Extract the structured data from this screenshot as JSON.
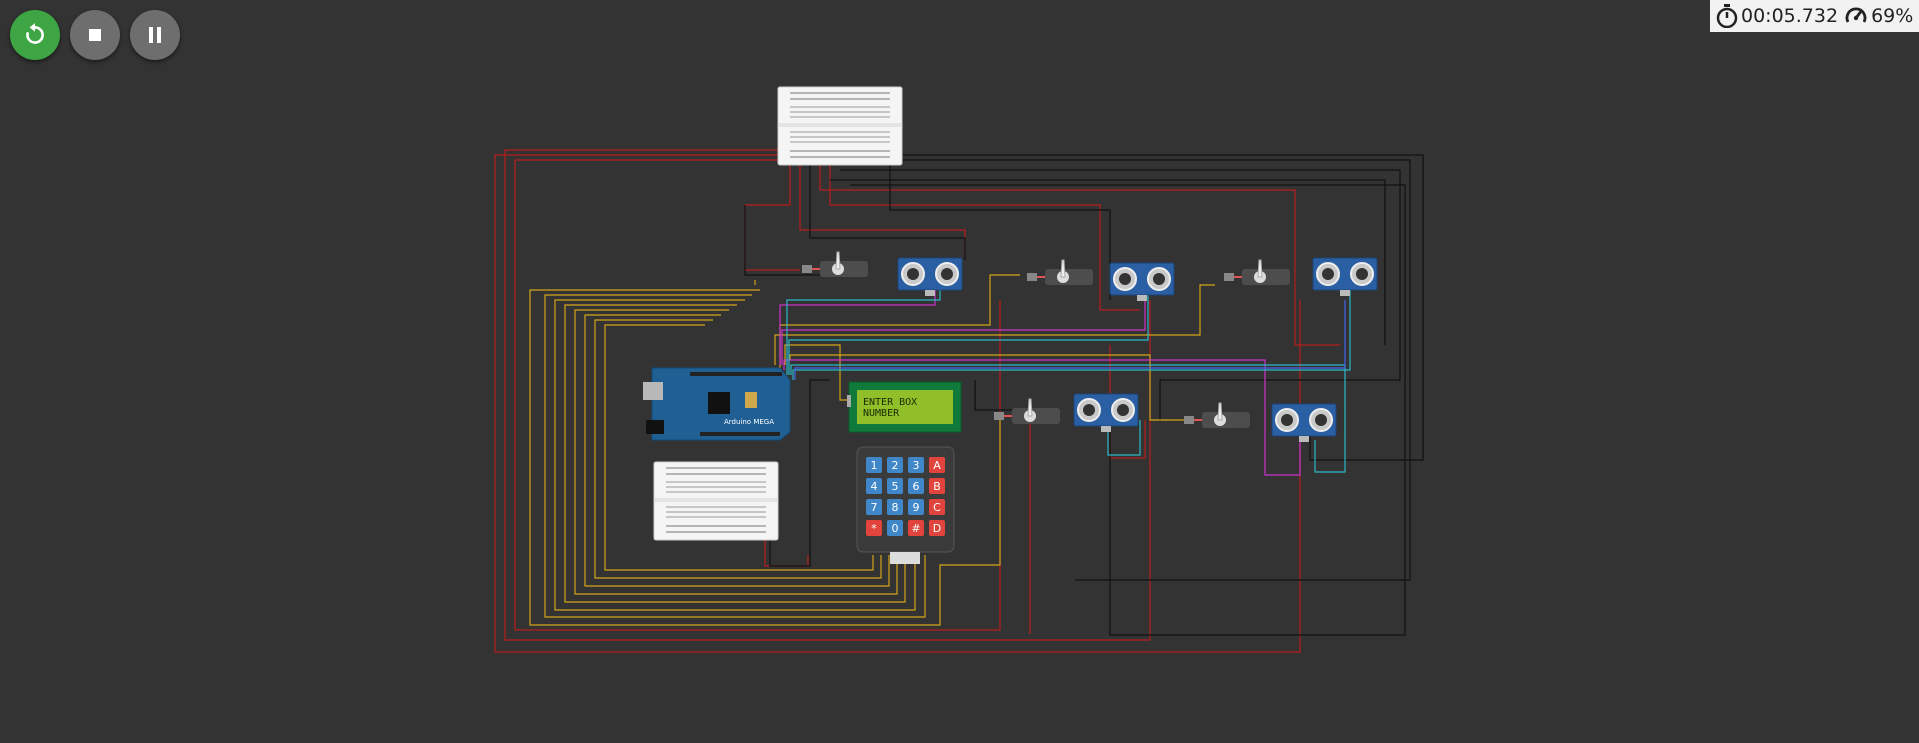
{
  "toolbar": {
    "restart": {
      "icon": "restart-icon",
      "color": "#3da544"
    },
    "stop": {
      "icon": "stop-icon",
      "color": "#6e6e6e"
    },
    "pause": {
      "icon": "pause-icon",
      "color": "#6e6e6e"
    }
  },
  "status": {
    "timer_icon": "stopwatch-icon",
    "elapsed": "00:05.732",
    "speed_icon": "speedometer-icon",
    "speed": "69%"
  },
  "circuit": {
    "board_label": "Arduino MEGA",
    "lcd": {
      "line1": "ENTER BOX",
      "line2": "NUMBER",
      "backlight": "#8fbf2a"
    },
    "keypad": {
      "keys": [
        [
          "1",
          "2",
          "3",
          "A"
        ],
        [
          "4",
          "5",
          "6",
          "B"
        ],
        [
          "7",
          "8",
          "9",
          "C"
        ],
        [
          "*",
          "0",
          "#",
          "D"
        ]
      ],
      "digit_color": "#3f87c8",
      "letter_color": "#e0443c"
    },
    "components": [
      "breadboard-top",
      "breadboard-bottom",
      "arduino-mega",
      "lcd-display",
      "keypad",
      "servo-1",
      "servo-2",
      "servo-3",
      "servo-4",
      "servo-5",
      "ultrasonic-1",
      "ultrasonic-2",
      "ultrasonic-3",
      "ultrasonic-4",
      "ultrasonic-5"
    ]
  }
}
